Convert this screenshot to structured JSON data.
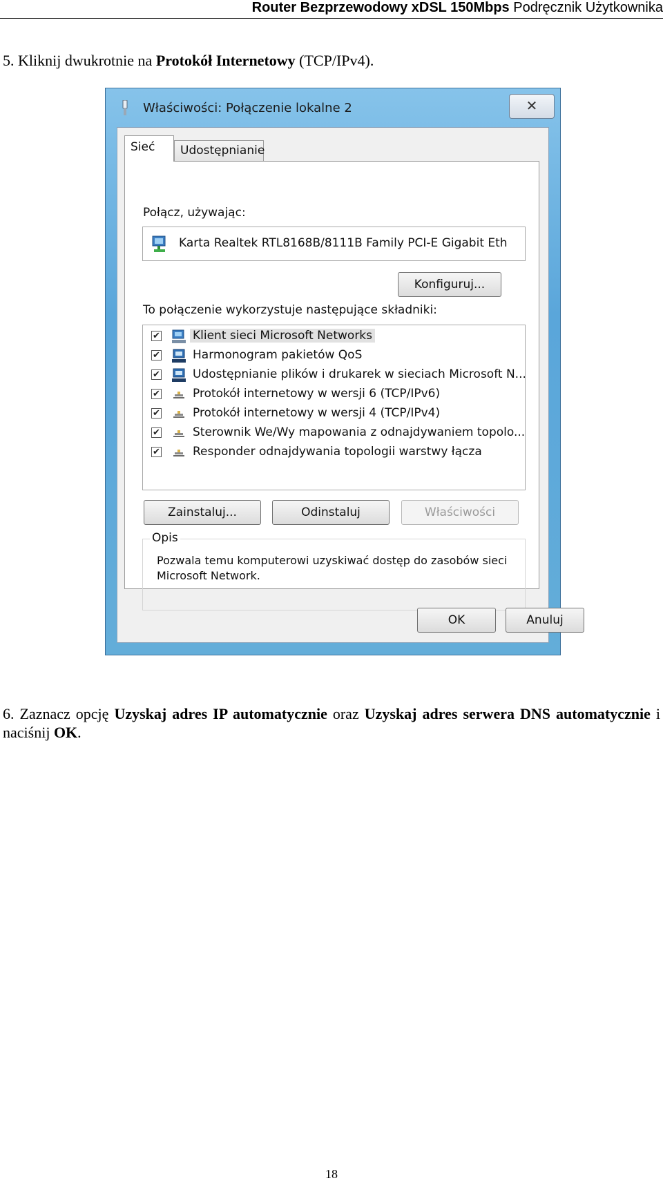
{
  "header": {
    "bold_text": "Router Bezprzewodowy xDSL 150Mbps",
    "normal_text": "Podręcznik Użytkownika"
  },
  "step5": {
    "prefix": "5. Kliknij dwukrotnie na ",
    "bold": "Protokół Internetowy",
    "suffix": " (TCP/IPv4)."
  },
  "dialog": {
    "title": "Właściwości: Połączenie lokalne 2",
    "close_glyph": "✕",
    "tabs": [
      {
        "label": "Sieć"
      },
      {
        "label": "Udostępnianie"
      }
    ],
    "connect_label": "Połącz, używając:",
    "adapter_name": "Karta Realtek RTL8168B/8111B Family PCI-E Gigabit Eth",
    "configure_label": "Konfiguruj...",
    "components_label": "To połączenie wykorzystuje następujące składniki:",
    "components": [
      {
        "label": "Klient sieci Microsoft Networks",
        "checked": true,
        "icon": "network-client-icon"
      },
      {
        "label": "Harmonogram pakietów QoS",
        "checked": true,
        "icon": "network-service-icon"
      },
      {
        "label": "Udostępnianie plików i drukarek w sieciach Microsoft N...",
        "checked": true,
        "icon": "network-service-icon"
      },
      {
        "label": "Protokół internetowy w wersji 6 (TCP/IPv6)",
        "checked": true,
        "icon": "protocol-icon"
      },
      {
        "label": "Protokół internetowy w wersji 4 (TCP/IPv4)",
        "checked": true,
        "icon": "protocol-icon"
      },
      {
        "label": "Sterownik We/Wy mapowania z odnajdywaniem topolo...",
        "checked": true,
        "icon": "protocol-icon"
      },
      {
        "label": "Responder odnajdywania topologii warstwy łącza",
        "checked": true,
        "icon": "protocol-icon"
      }
    ],
    "install_label": "Zainstaluj...",
    "uninstall_label": "Odinstaluj",
    "properties_label": "Właściwości",
    "description_title": "Opis",
    "description_text": "Pozwala temu komputerowi uzyskiwać dostęp do zasobów sieci Microsoft Network.",
    "ok_label": "OK",
    "cancel_label": "Anuluj",
    "check_glyph": "✔"
  },
  "step6": {
    "prefix": "6. Zaznacz opcję ",
    "bold1": "Uzyskaj adres IP automatycznie",
    "middle": " oraz ",
    "bold2": "Uzyskaj adres serwera DNS automatycznie",
    "middle2": " i naciśnij ",
    "bold3": "OK",
    "suffix": "."
  },
  "page_number": "18"
}
